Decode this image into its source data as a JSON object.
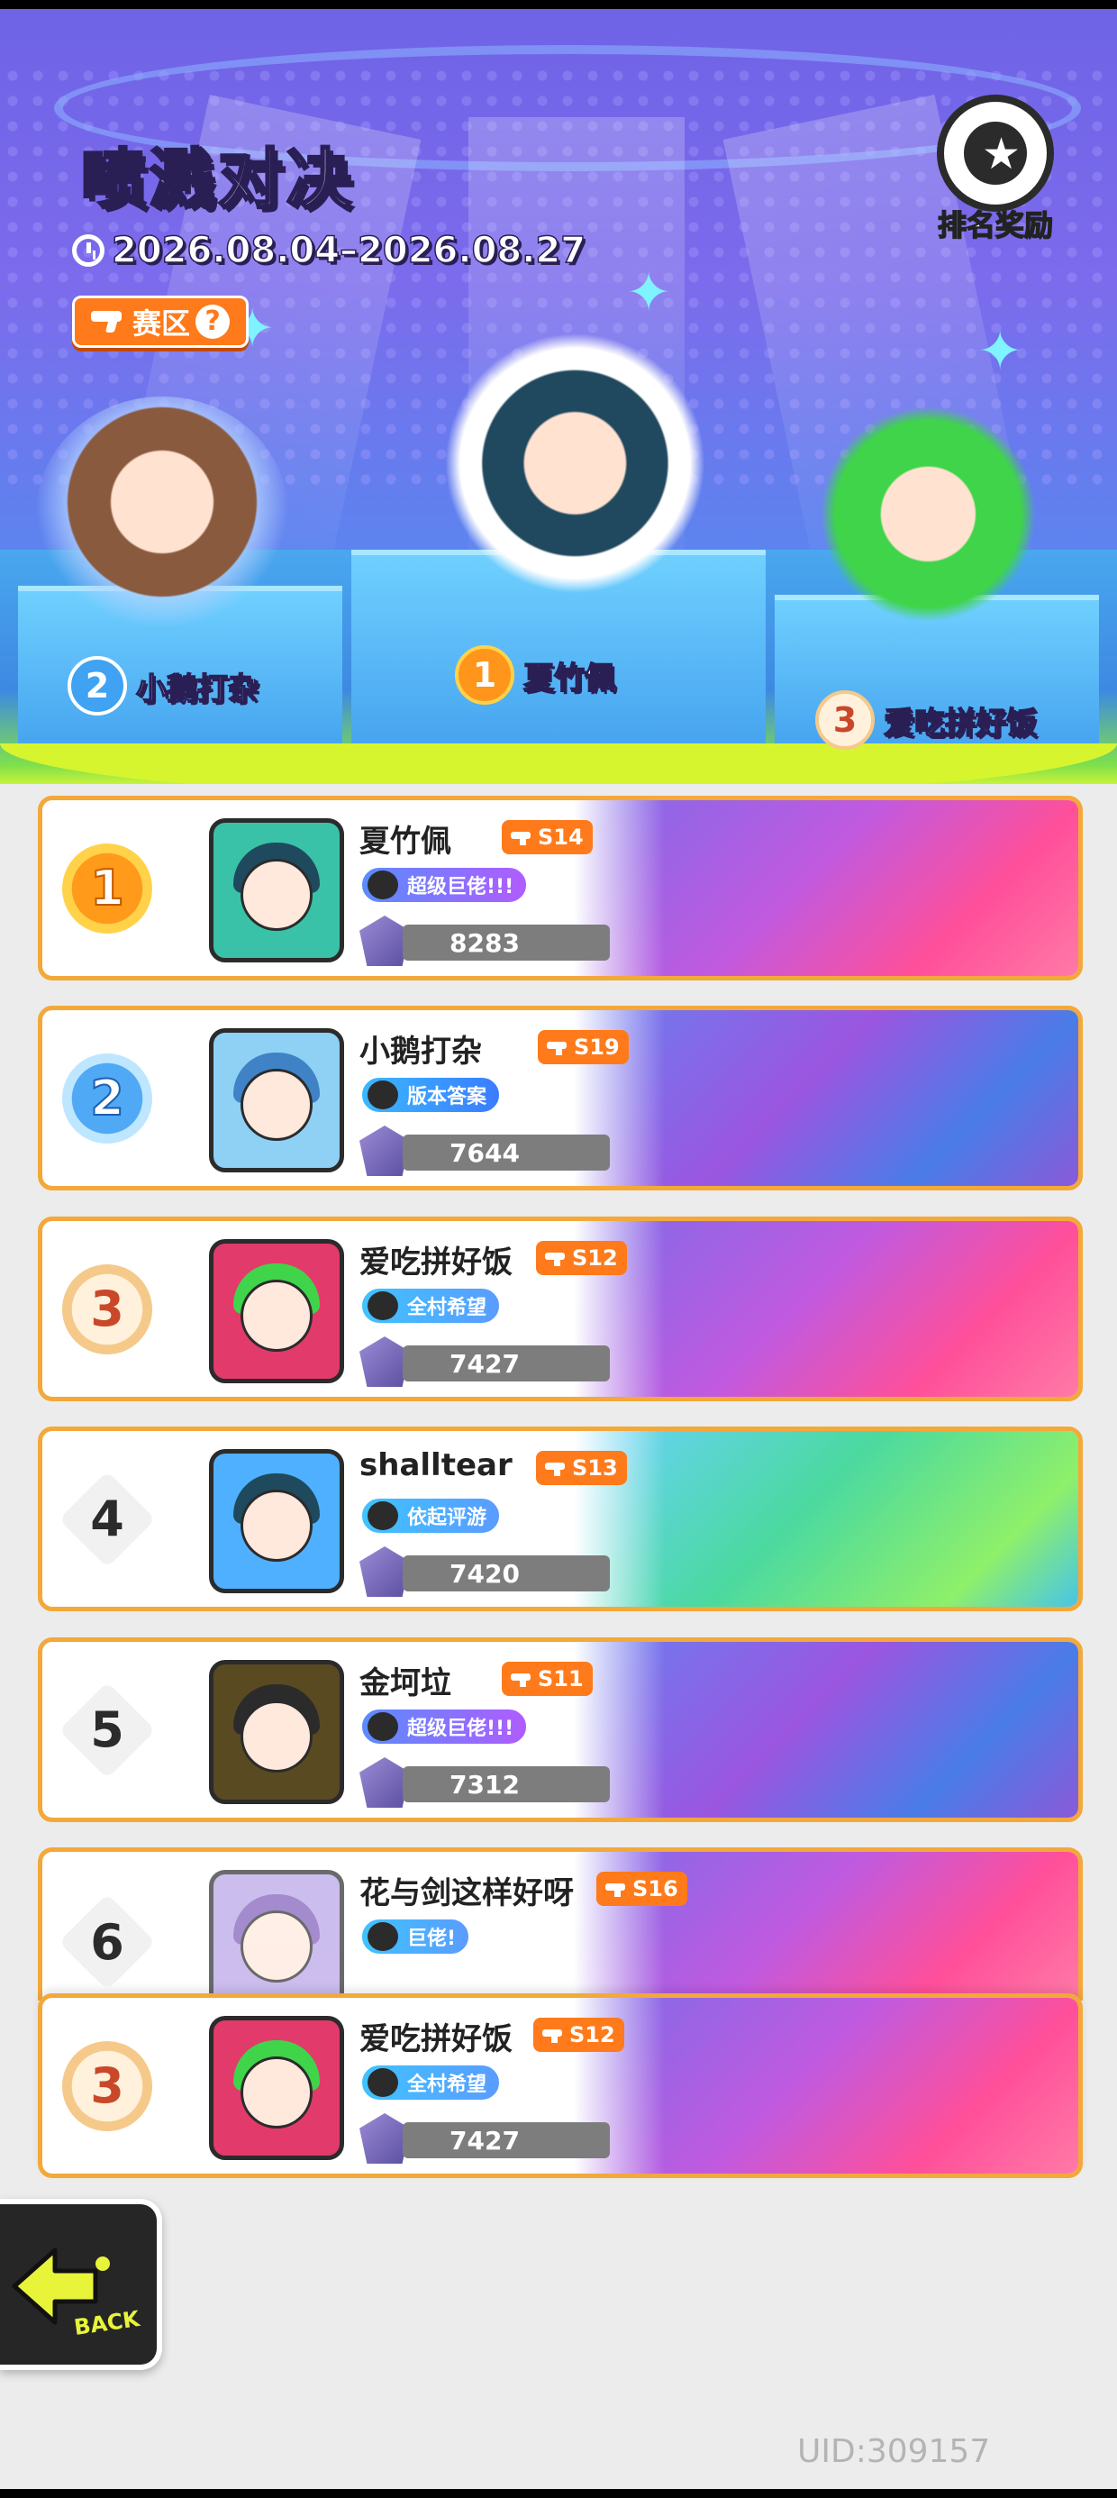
{
  "event": {
    "title_highlight": "喷溅",
    "title_rest": "对决",
    "date_range": "2026.08.04–2026.08.27",
    "zone_label": "赛区",
    "zone_help": "?",
    "reward_label": "排名奖励"
  },
  "podium": [
    {
      "rank": "2",
      "name": "小鹅打杂"
    },
    {
      "rank": "1",
      "name": "夏竹佩"
    },
    {
      "rank": "3",
      "name": "爱吃拼好饭"
    }
  ],
  "leaderboard": [
    {
      "rank": "1",
      "name": "夏竹佩",
      "season": "S14",
      "title": "超级巨佬!!!",
      "score": "8283"
    },
    {
      "rank": "2",
      "name": "小鹅打杂",
      "season": "S19",
      "title": "版本答案",
      "score": "7644"
    },
    {
      "rank": "3",
      "name": "爱吃拼好饭",
      "season": "S12",
      "title": "全村希望",
      "score": "7427"
    },
    {
      "rank": "4",
      "name": "shalltear",
      "season": "S13",
      "title": "依起评游",
      "score": "7420"
    },
    {
      "rank": "5",
      "name": "金坷垃",
      "season": "S11",
      "title": "超级巨佬!!!",
      "score": "7312"
    },
    {
      "rank": "6",
      "name": "花与剑这样好呀",
      "season": "S16",
      "title": "巨佬!",
      "score": ""
    }
  ],
  "self_row": {
    "rank": "3",
    "name": "爱吃拼好饭",
    "season": "S12",
    "title": "全村希望",
    "score": "7427"
  },
  "back_label": "BACK",
  "uid": "UID:309157",
  "colors": {
    "accent": "#ff7a1a",
    "card_border": "#f3a83a",
    "header": "#6f63e6",
    "slime": "#d6f52e"
  }
}
